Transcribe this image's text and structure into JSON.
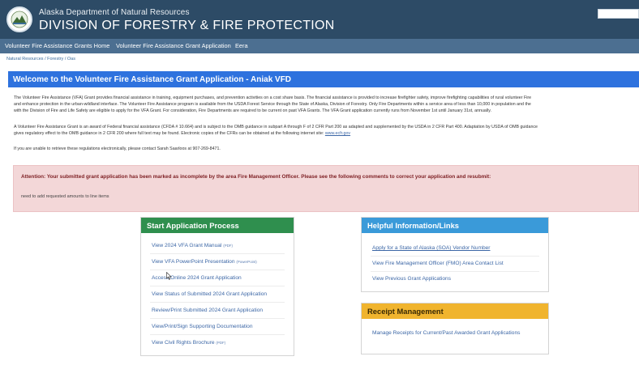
{
  "header": {
    "agency": "Alaska Department of Natural Resources",
    "division": "DIVISION OF FORESTRY & FIRE PROTECTION"
  },
  "nav": {
    "items": [
      "Volunteer Fire Assistance Grants Home",
      "Volunteer Fire Assistance Grant Application",
      "Eera"
    ]
  },
  "breadcrumb": "Natural Resources / Forestry / Oas",
  "welcome": {
    "title": "Welcome to the Volunteer Fire Assistance Grant Application - Aniak VFD",
    "para1": [
      "The Volunteer Fire Assistance (VFA) Grant provides financial assistance in training, equipment purchases, and prevention activities on a cost share basis. The financial assistance is provided to increase firefighter safety, improve firefighting capabilities of rural volunteer Fire",
      "and enhance protection in the urban-wildland interface. The Volunteer Fire Assistance program is available from the USDA Forest Service through the State of Alaska, Division of Forestry. Only Fire Departments within a service area of less than 10,000 in population and the",
      "with the Division of Fire and Life Safety are eligible to apply for the VFA Grant. For consideration, Fire Departments are required to be current on past VFA Grants. The VFA Grant application currently runs from November 1st until January 31st, annually."
    ],
    "para2": [
      "A Volunteer Fire Assistance Grant is an award of Federal financial assistance (CFDA # 10.664) and is subject to the OMB guidance in subpart A through F of 2 CFR Part 200 as adapted and supplemented by the USDA in 2 CFR Part 400. Adaptation by USDA of OMB guidance",
      "gives regulatory effect to the OMB guidance in 2 CFR 200 where full text may be found. Electronic copies of the CFRs can be obtained at the following internet site:"
    ],
    "para2_link": "www.ecfr.gov",
    "para3": "If you are unable to retrieve these regulations electronically, please contact Sarah Saarloos at 907-269-8471."
  },
  "alert": {
    "title": "Attention: Your submitted grant application has been marked as incomplete by the area Fire Management Officer. Please see the following comments to correct your application and resubmit:",
    "comment": "need to add requested amounts to line items"
  },
  "start_panel": {
    "title": "Start Application Process",
    "items": [
      {
        "label": "View 2024 VFA Grant Manual",
        "tag": "(PDF)"
      },
      {
        "label": "View VFA PowerPoint Presentation",
        "tag": "(PowerPoint)"
      },
      {
        "label": "Access Online 2024 Grant Application",
        "tag": ""
      },
      {
        "label": "View Status of Submitted 2024 Grant Application",
        "tag": ""
      },
      {
        "label": "Review/Print Submitted 2024 Grant Application",
        "tag": ""
      },
      {
        "label": "View/Print/Sign Supporting Documentation",
        "tag": ""
      },
      {
        "label": "View Civil Rights Brochure",
        "tag": "(PDF)"
      }
    ]
  },
  "info_panel": {
    "title": "Helpful Information/Links",
    "items": [
      "Apply for a State of Alaska (SOA) Vendor Number",
      "View Fire Management Officer (FMO) Area Contact List",
      "View Previous Grant Applications"
    ]
  },
  "receipt_panel": {
    "title": "Receipt Management",
    "items": [
      "Manage Receipts for Current/Past Awarded Grant Applications"
    ]
  },
  "colors": {
    "header": "#2d4b66",
    "nav": "#4c6f91",
    "welcome_bar": "#2e72de",
    "alert_bg": "#f3d7d8",
    "green": "#2f8f4e",
    "blue": "#3a9ad9",
    "amber": "#f0b42e",
    "link": "#3c67a6"
  }
}
